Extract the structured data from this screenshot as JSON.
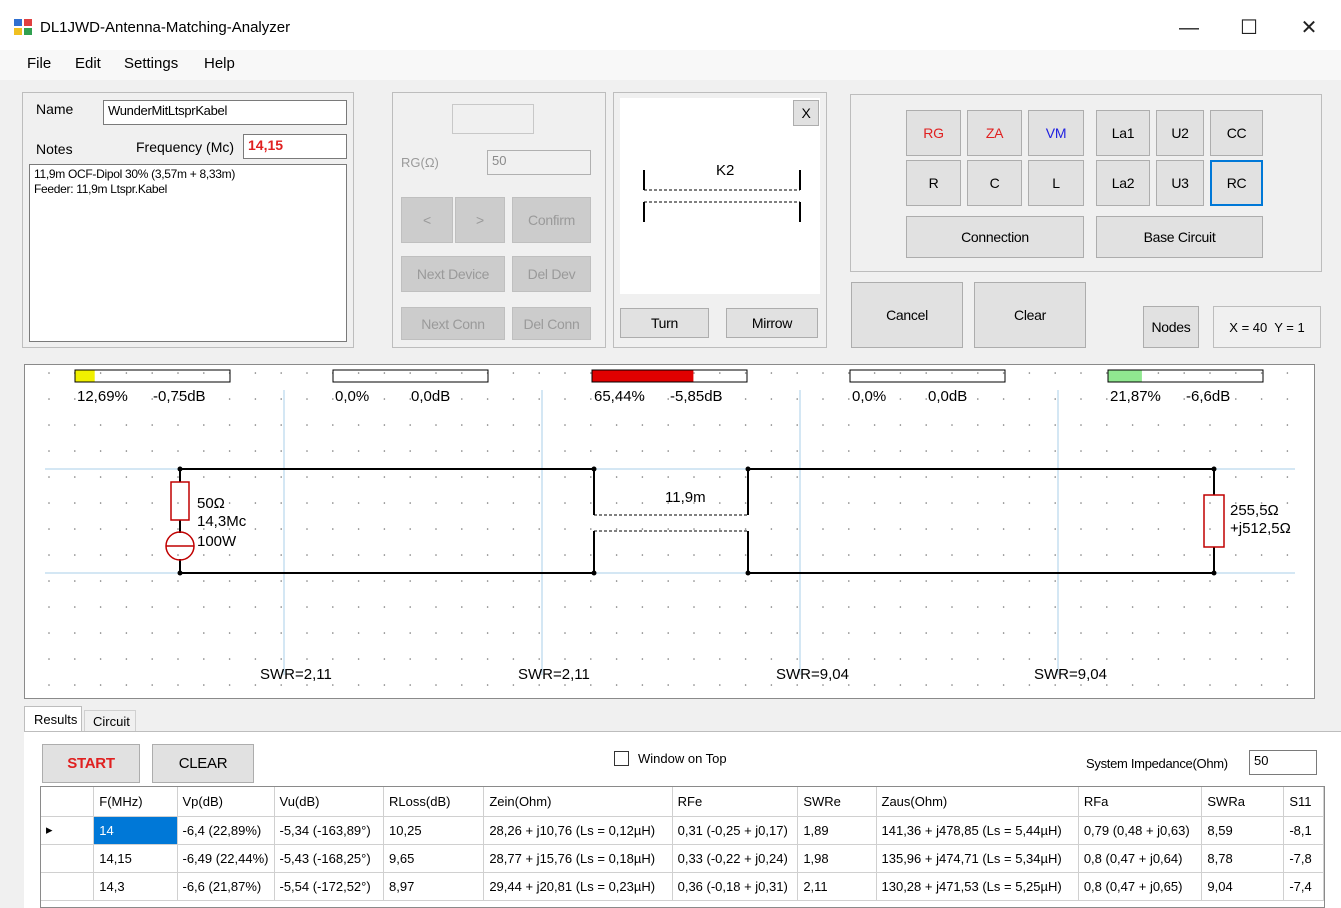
{
  "window": {
    "title": "DL1JWD-Antenna-Matching-Analyzer",
    "minimize": "—",
    "maximize": "☐",
    "close": "✕"
  },
  "menu": [
    "File",
    "Edit",
    "Settings",
    "Help"
  ],
  "left_panel": {
    "name_label": "Name",
    "name_value": "WunderMitLtsprKabel",
    "notes_label": "Notes",
    "frequency_label": "Frequency (Mc)",
    "frequency_value": "14,15",
    "notes_line1": "11,9m OCF-Dipol 30% (3,57m + 8,33m)",
    "notes_line2": "Feeder: 11,9m Ltspr.Kabel"
  },
  "device_panel": {
    "rg_label": "RG(Ω)",
    "rg_value": "50",
    "prev": "<",
    "next": ">",
    "confirm": "Confirm",
    "next_device": "Next Device",
    "del_dev": "Del Dev",
    "next_conn": "Next Conn",
    "del_conn": "Del Conn"
  },
  "preview": {
    "close": "X",
    "component_label": "K2",
    "turn": "Turn",
    "mirrow": "Mirrow"
  },
  "components": {
    "rg": "RG",
    "za": "ZA",
    "vm": "VM",
    "la1": "La1",
    "u2": "U2",
    "cc": "CC",
    "r": "R",
    "c": "C",
    "l": "L",
    "la2": "La2",
    "u3": "U3",
    "rc": "RC",
    "connection": "Connection",
    "base_circuit": "Base Circuit",
    "colors": {
      "red": "#e02020",
      "blue": "#2020e0"
    }
  },
  "actions": {
    "cancel": "Cancel",
    "clear": "Clear",
    "nodes": "Nodes",
    "coords": "X = 40  Y = 1"
  },
  "circuit": {
    "meters": [
      {
        "pct": "12,69%",
        "db": "-0,75dB",
        "fill": 0.1269,
        "color": "#f0f000"
      },
      {
        "pct": "0,0%",
        "db": "0,0dB",
        "fill": 0,
        "color": "#ffffff"
      },
      {
        "pct": "65,44%",
        "db": "-5,85dB",
        "fill": 0.6544,
        "color": "#e00000"
      },
      {
        "pct": "0,0%",
        "db": "0,0dB",
        "fill": 0,
        "color": "#ffffff"
      },
      {
        "pct": "21,87%",
        "db": "-6,6dB",
        "fill": 0.2187,
        "color": "#90e890"
      }
    ],
    "source_r": "50Ω",
    "source_f": "14,3Mc",
    "source_p": "100W",
    "cable_len": "11,9m",
    "load_r": "255,5Ω",
    "load_x": "+j512,5Ω",
    "swr": [
      "SWR=2,11",
      "SWR=2,11",
      "SWR=9,04",
      "SWR=9,04"
    ]
  },
  "tabs": [
    "Results",
    "Circuit"
  ],
  "results": {
    "start": "START",
    "clear": "CLEAR",
    "window_on_top": "Window on Top",
    "sys_imp_label": "System Impedance(Ohm)",
    "sys_imp_value": "50",
    "columns": [
      "",
      "F(MHz)",
      "Vp(dB)",
      "Vu(dB)",
      "RLoss(dB)",
      "Zein(Ohm)",
      "RFe",
      "SWRe",
      "Zaus(Ohm)",
      "RFa",
      "SWRa",
      "S11"
    ],
    "rows": [
      [
        "▸",
        "14",
        "-6,4 (22,89%)",
        "-5,34 (-163,89°)",
        "10,25",
        "28,26 + j10,76  (Ls = 0,12µH)",
        "0,31 (-0,25 + j0,17)",
        "1,89",
        "141,36 + j478,85  (Ls = 5,44µH)",
        "0,79 (0,48 + j0,63)",
        "8,59",
        "-8,1"
      ],
      [
        "",
        "14,15",
        "-6,49 (22,44%)",
        "-5,43 (-168,25°)",
        "9,65",
        "28,77 + j15,76  (Ls = 0,18µH)",
        "0,33 (-0,22 + j0,24)",
        "1,98",
        "135,96 + j474,71  (Ls = 5,34µH)",
        "0,8 (0,47 + j0,64)",
        "8,78",
        "-7,8"
      ],
      [
        "",
        "14,3",
        "-6,6 (21,87%)",
        "-5,54 (-172,52°)",
        "8,97",
        "29,44 + j20,81  (Ls = 0,23µH)",
        "0,36 (-0,18 + j0,31)",
        "2,11",
        "130,28 + j471,53  (Ls = 5,25µH)",
        "0,8 (0,47 + j0,65)",
        "9,04",
        "-7,4"
      ]
    ]
  }
}
